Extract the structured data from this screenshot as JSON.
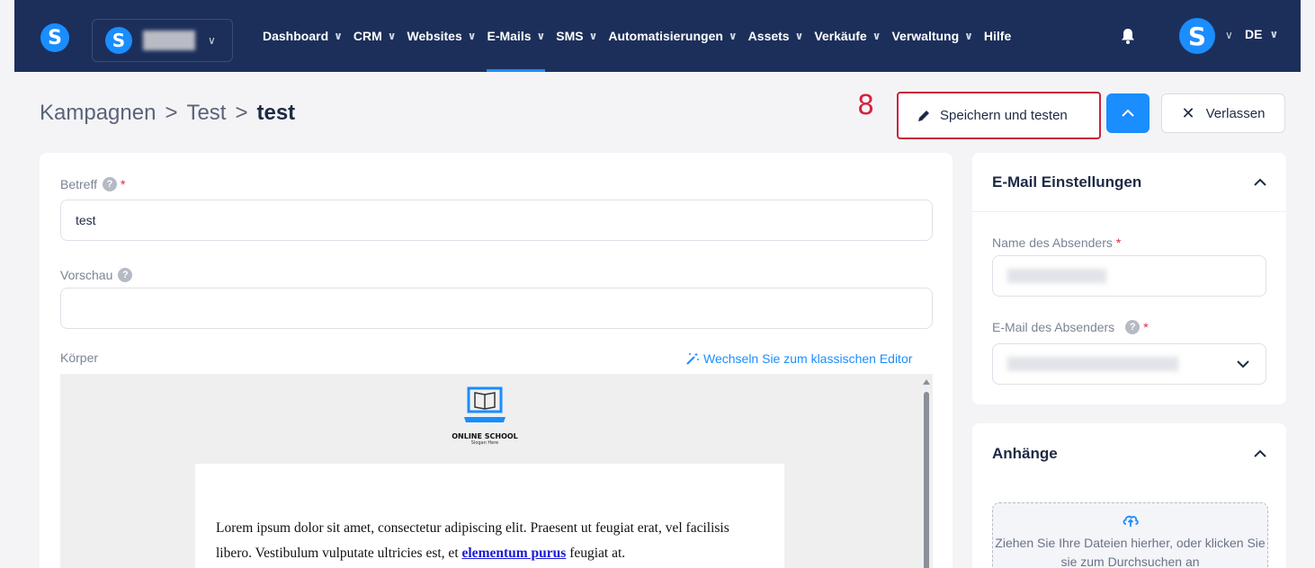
{
  "navbar": {
    "app_logo_letter": "S",
    "account_logo_letter": "S",
    "items": [
      {
        "label": "Dashboard",
        "has_dropdown": true
      },
      {
        "label": "CRM",
        "has_dropdown": true
      },
      {
        "label": "Websites",
        "has_dropdown": true
      },
      {
        "label": "E-Mails",
        "has_dropdown": true,
        "active": true
      },
      {
        "label": "SMS",
        "has_dropdown": true
      },
      {
        "label": "Automatisierungen",
        "has_dropdown": true
      },
      {
        "label": "Assets",
        "has_dropdown": true
      },
      {
        "label": "Verkäufe",
        "has_dropdown": true
      },
      {
        "label": "Verwaltung",
        "has_dropdown": true
      },
      {
        "label": "Hilfe",
        "has_dropdown": false
      }
    ],
    "user_avatar_letter": "S",
    "language": "DE",
    "icons": [
      "bell-icon",
      "chevron-down-icon"
    ]
  },
  "breadcrumb": {
    "items": [
      "Kampagnen",
      "Test"
    ],
    "separator": ">",
    "current": "test"
  },
  "annotation": {
    "step_number": "8"
  },
  "actions": {
    "save_label": "Speichern und testen",
    "leave_label": "Verlassen"
  },
  "form": {
    "subject_label": "Betreff",
    "subject_value": "test",
    "preview_label": "Vorschau",
    "preview_value": "",
    "body_label": "Körper",
    "switch_editor_label": "Wechseln Sie zum klassischen Editor"
  },
  "email_preview": {
    "logo_title": "ONLINE SCHOOL",
    "logo_slogan": "Slogan Here",
    "paragraph_start": "Lorem ipsum dolor sit amet, consectetur adipiscing elit. Praesent ut feugiat erat, vel facilisis libero. Vestibulum vulputate ultricies est, et ",
    "link_text": "elementum purus",
    "paragraph_end": " feugiat at."
  },
  "settings_panel": {
    "title": "E-Mail Einstellungen",
    "sender_name_label": "Name des Absenders",
    "sender_email_label": "E-Mail des Absenders"
  },
  "attachments_panel": {
    "title": "Anhänge",
    "dropzone_text": "Ziehen Sie Ihre Dateien hierher, oder klicken Sie sie zum Durchsuchen an"
  },
  "colors": {
    "navbar_bg": "#1c2f5a",
    "accent": "#1a8dff",
    "annotation_red": "#c8233a"
  }
}
